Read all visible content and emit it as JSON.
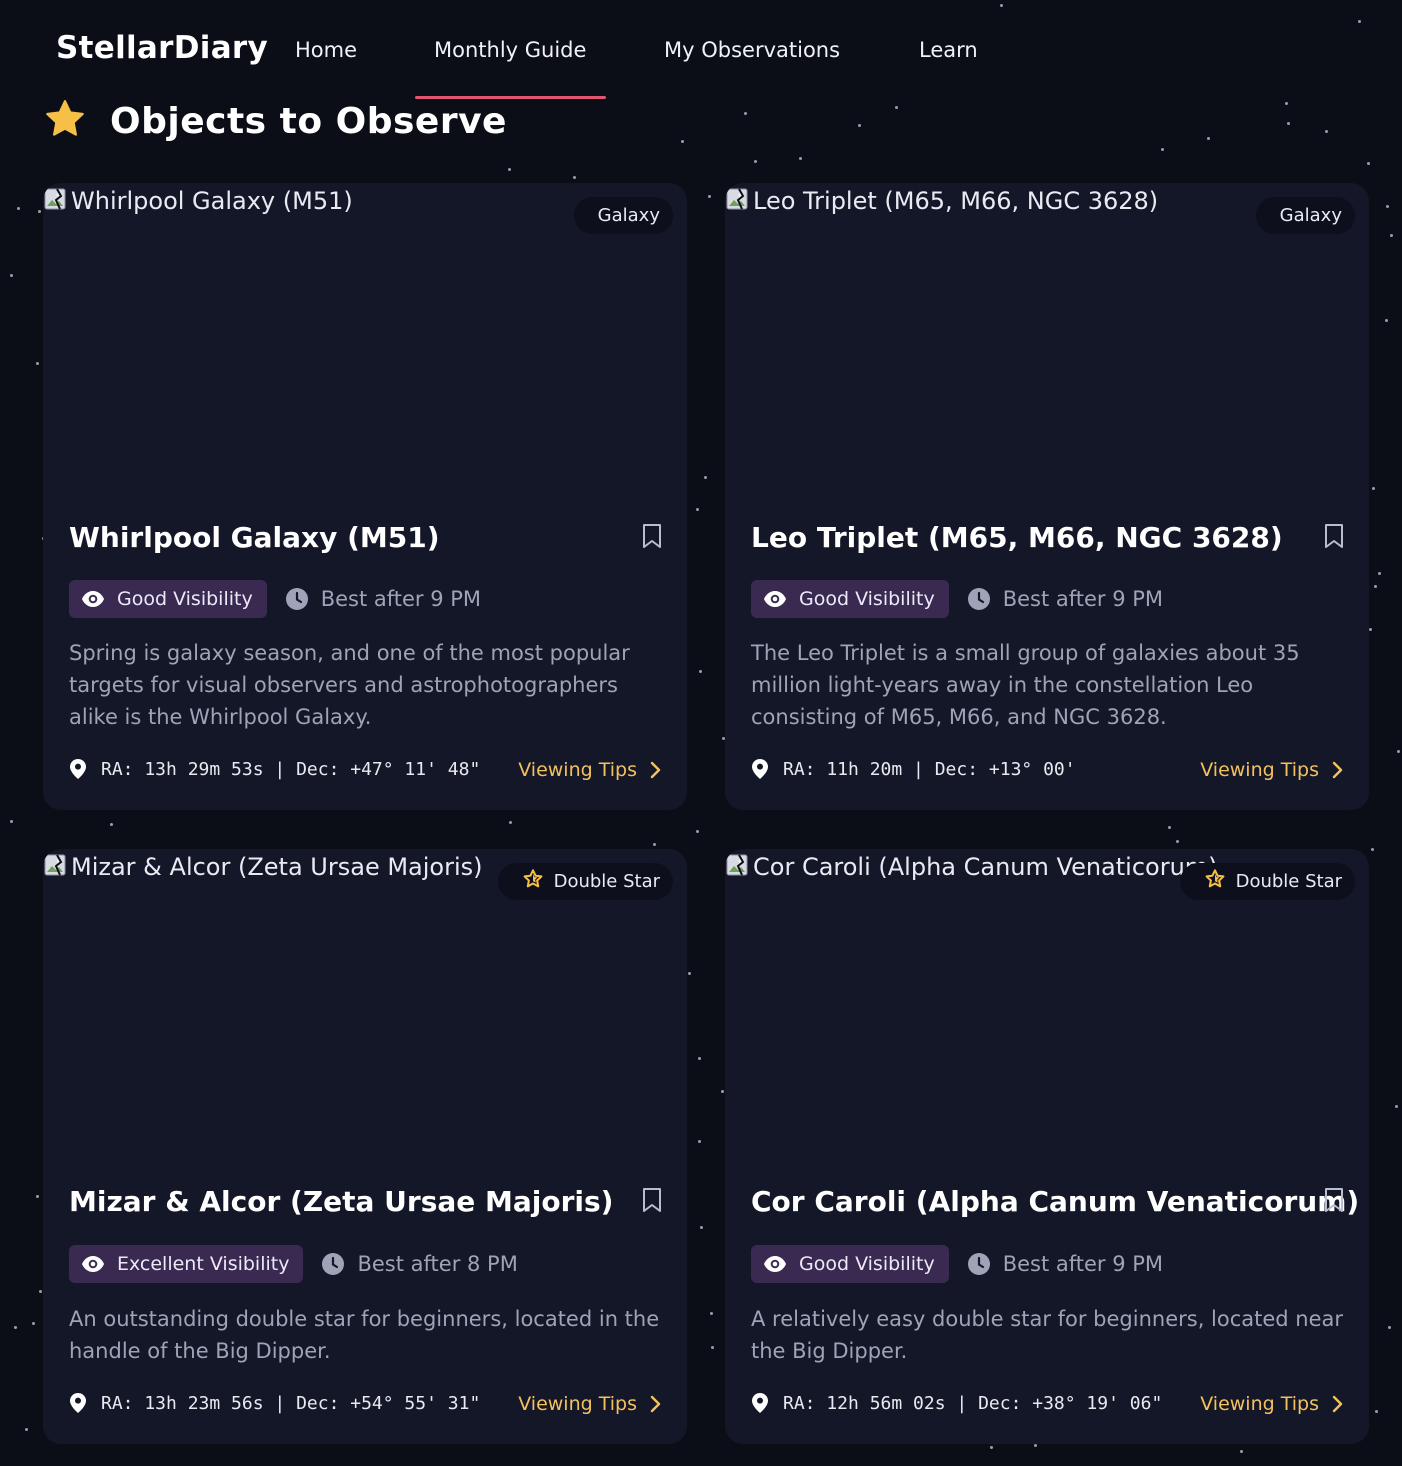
{
  "nav": {
    "logo": "StellarDiary",
    "items": [
      {
        "label": "Home"
      },
      {
        "label": "Monthly Guide"
      },
      {
        "label": "My Observations"
      },
      {
        "label": "Learn"
      }
    ],
    "active_index": 1
  },
  "section": {
    "title": "Objects to Observe",
    "icon": "star-icon"
  },
  "colors": {
    "background": "#0b0d17",
    "card": "#141727",
    "accent_underline": "#e0556f",
    "visibility_pill": "#3a2a52",
    "link": "#f4c15c",
    "star": "#f6c046"
  },
  "cards": [
    {
      "image_alt": "Whirlpool Galaxy (M51)",
      "badge": "Galaxy",
      "badge_icon": null,
      "title": "Whirlpool Galaxy (M51)",
      "visibility": "Good Visibility",
      "best_time": "Best after 9 PM",
      "description": "Spring is galaxy season, and one of the most popular targets for visual observers and astrophotographers alike is the Whirlpool Galaxy.",
      "coordinates": "RA: 13h 29m 53s | Dec: +47° 11' 48\"",
      "link": "Viewing Tips"
    },
    {
      "image_alt": "Leo Triplet (M65, M66, NGC 3628)",
      "badge": "Galaxy",
      "badge_icon": null,
      "title": "Leo Triplet (M65, M66, NGC 3628)",
      "visibility": "Good Visibility",
      "best_time": "Best after 9 PM",
      "description": "The Leo Triplet is a small group of galaxies about 35 million light-years away in the constellation Leo consisting of M65, M66, and NGC 3628.",
      "coordinates": "RA: 11h 20m | Dec: +13° 00'",
      "link": "Viewing Tips"
    },
    {
      "image_alt": "Mizar & Alcor (Zeta Ursae Majoris)",
      "badge": "Double Star",
      "badge_icon": "star-outline-icon",
      "title": "Mizar & Alcor (Zeta Ursae Majoris)",
      "visibility": "Excellent Visibility",
      "best_time": "Best after 8 PM",
      "description": "An outstanding double star for beginners, located in the handle of the Big Dipper.",
      "coordinates": "RA: 13h 23m 56s | Dec: +54° 55' 31\"",
      "link": "Viewing Tips"
    },
    {
      "image_alt": "Cor Caroli (Alpha Canum Venaticorum)",
      "badge": "Double Star",
      "badge_icon": "star-outline-icon",
      "title": "Cor Caroli (Alpha Canum Venaticorum)",
      "visibility": "Good Visibility",
      "best_time": "Best after 9 PM",
      "description": "A relatively easy double star for beginners, located near the Big Dipper.",
      "coordinates": "RA: 12h 56m 02s | Dec: +38° 19' 06\"",
      "link": "Viewing Tips"
    }
  ]
}
